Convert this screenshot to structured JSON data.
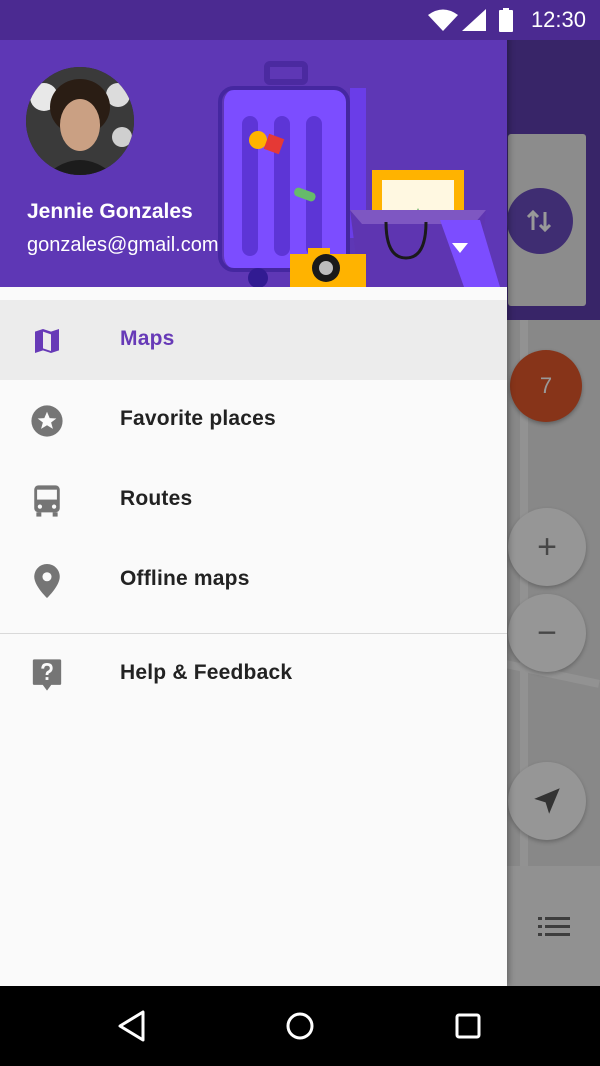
{
  "status_bar": {
    "time": "12:30"
  },
  "background": {
    "badge_count": "7"
  },
  "drawer": {
    "header": {
      "user_name": "Jennie Gonzales",
      "user_email": "gonzales@gmail.com"
    },
    "items": [
      {
        "label": "Maps",
        "icon": "map-icon",
        "active": true
      },
      {
        "label": "Favorite places",
        "icon": "star-icon"
      },
      {
        "label": "Routes",
        "icon": "bus-icon"
      },
      {
        "label": "Offline maps",
        "icon": "location-pin-icon"
      }
    ],
    "secondary_items": [
      {
        "label": "Help & Feedback",
        "icon": "help-icon"
      }
    ]
  },
  "colors": {
    "accent": "#673ab7",
    "header_bg": "#5e37b5",
    "status_bar_bg": "#4b2a91"
  }
}
